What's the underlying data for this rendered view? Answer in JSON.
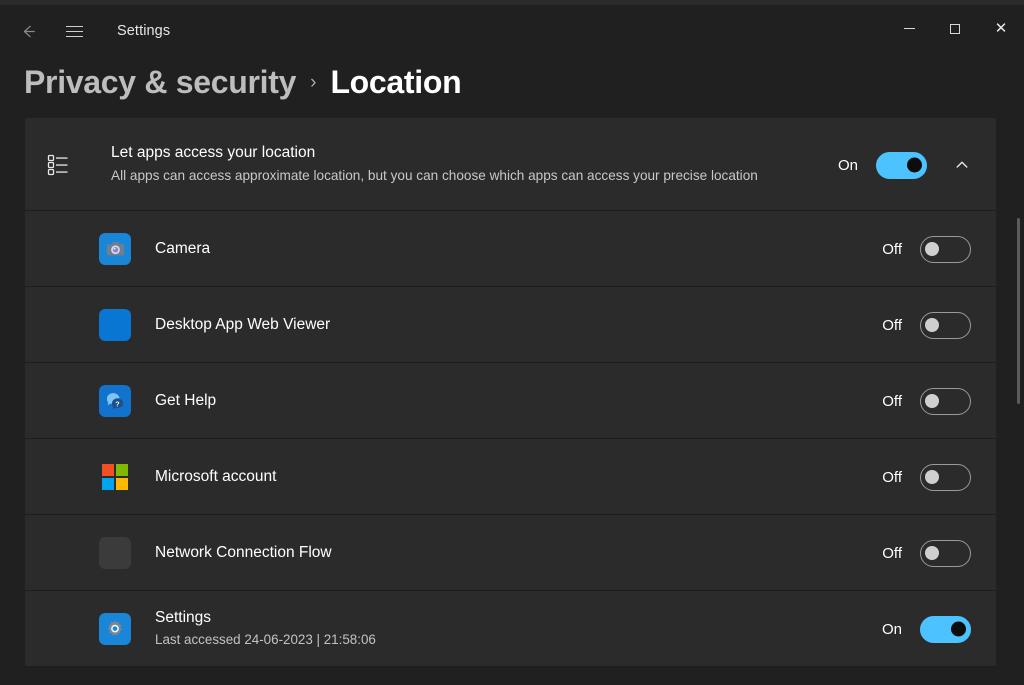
{
  "window": {
    "app_title": "Settings",
    "back_icon": "back-arrow-icon",
    "menu_icon": "hamburger-menu-icon",
    "minimize_label": "Minimize",
    "maximize_label": "Maximize",
    "close_label": "Close",
    "close_glyph": "✕"
  },
  "breadcrumb": {
    "parent": "Privacy & security",
    "separator": "›",
    "current": "Location"
  },
  "header_card": {
    "icon": "app-permissions-list-icon",
    "title": "Let apps access your location",
    "description": "All apps can access approximate location, but you can choose which apps can access your precise location",
    "state_label": "On",
    "toggle_state": "on",
    "expander_icon": "chevron-up-icon"
  },
  "apps": [
    {
      "name": "Camera",
      "sub": "",
      "icon": "camera-app-icon",
      "state_label": "Off",
      "toggle_state": "off",
      "highlighted": false
    },
    {
      "name": "Desktop App Web Viewer",
      "sub": "",
      "icon": "desktop-app-web-viewer-icon",
      "state_label": "Off",
      "toggle_state": "off",
      "highlighted": false
    },
    {
      "name": "Get Help",
      "sub": "",
      "icon": "get-help-icon",
      "state_label": "Off",
      "toggle_state": "off",
      "highlighted": false
    },
    {
      "name": "Microsoft account",
      "sub": "",
      "icon": "microsoft-account-icon",
      "state_label": "Off",
      "toggle_state": "off",
      "highlighted": false
    },
    {
      "name": "Network Connection Flow",
      "sub": "",
      "icon": "network-connection-flow-icon",
      "state_label": "Off",
      "toggle_state": "off",
      "highlighted": false
    },
    {
      "name": "Settings",
      "sub": "Last accessed 24-06-2023  |  21:58:06",
      "icon": "settings-app-icon",
      "state_label": "On",
      "toggle_state": "on",
      "highlighted": true
    }
  ],
  "colors": {
    "window_background": "#202020",
    "card_background": "#2b2b2b",
    "accent_toggle_on": "#4cc2ff",
    "highlight_box": "#cc0000",
    "text_primary": "#ffffff",
    "text_secondary": "#c8c8c8",
    "scrollbar_thumb": "#5c5c5c"
  },
  "scrollbar": {
    "name": "vertical-scrollbar"
  }
}
